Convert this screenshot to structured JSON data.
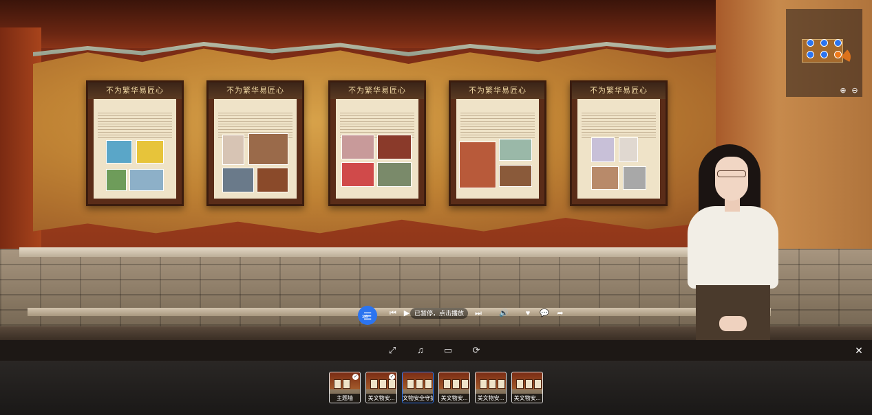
{
  "posters": [
    {
      "title": "不为繁华易匠心"
    },
    {
      "title": "不为繁华易匠心"
    },
    {
      "title": "不为繁华易匠心"
    },
    {
      "title": "不为繁华易匠心"
    },
    {
      "title": "不为繁华易匠心"
    }
  ],
  "player": {
    "scene_count": "3/6",
    "status_text": "已暂停，点击播放"
  },
  "icons": {
    "list": "list-icon",
    "prev": "skip-previous-icon",
    "play": "play-icon",
    "next": "skip-next-icon",
    "volume": "volume-icon",
    "like": "heart-icon",
    "comment": "comment-icon",
    "share": "share-icon",
    "fullscreen": "fullscreen-icon",
    "music": "music-icon",
    "vr": "vr-glasses-icon",
    "gyro": "gyroscope-icon",
    "close": "close-icon",
    "zoom_in": "zoom-in-icon",
    "zoom_out": "zoom-out-icon"
  },
  "thumbnails": [
    {
      "label": "主题墙",
      "status": "visited"
    },
    {
      "label": "美文物安...",
      "status": "visited"
    },
    {
      "label": "文物安全守护",
      "status": "current"
    },
    {
      "label": "美文物安...",
      "status": ""
    },
    {
      "label": "美文物安...",
      "status": ""
    },
    {
      "label": "美文物安...",
      "status": ""
    }
  ],
  "colors": {
    "accent": "#2b74f0",
    "minimap_active": "#f07a1a"
  }
}
